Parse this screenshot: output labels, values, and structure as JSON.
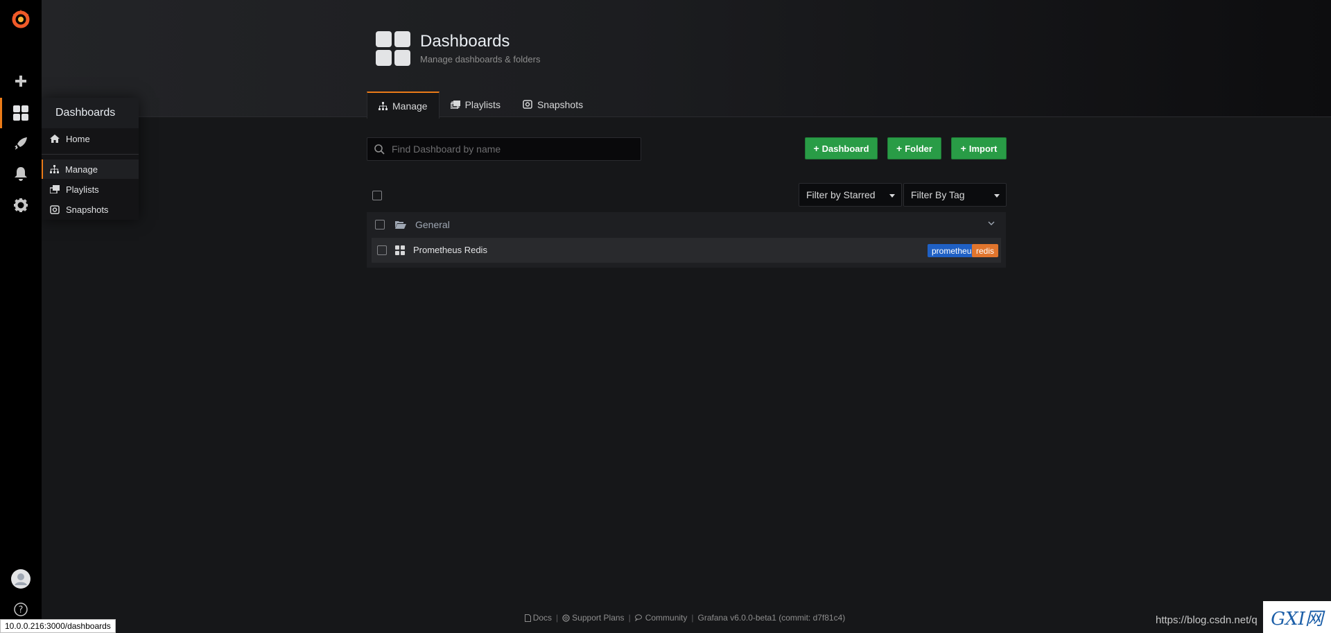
{
  "header": {
    "title": "Dashboards",
    "subtitle": "Manage dashboards & folders"
  },
  "tabs": [
    {
      "label": "Manage",
      "icon": "sitemap-icon",
      "active": true
    },
    {
      "label": "Playlists",
      "icon": "playlist-icon",
      "active": false
    },
    {
      "label": "Snapshots",
      "icon": "camera-icon",
      "active": false
    }
  ],
  "search": {
    "placeholder": "Find Dashboard by name",
    "value": ""
  },
  "actions": {
    "new_dashboard": "Dashboard",
    "new_folder": "Folder",
    "import": "Import"
  },
  "filters": {
    "starred": "Filter by Starred",
    "tag": "Filter By Tag"
  },
  "folders": [
    {
      "name": "General",
      "dashboards": [
        {
          "name": "Prometheus Redis",
          "tags": [
            {
              "label": "prometheus",
              "color": "#1f60c4"
            },
            {
              "label": "redis",
              "color": "#e0752d"
            }
          ]
        }
      ]
    }
  ],
  "sidemenu_dropdown": {
    "title": "Dashboards",
    "items": [
      {
        "label": "Home",
        "icon": "home-icon"
      },
      {
        "label": "Manage",
        "icon": "sitemap-icon",
        "active": true
      },
      {
        "label": "Playlists",
        "icon": "playlist-icon"
      },
      {
        "label": "Snapshots",
        "icon": "camera-icon"
      }
    ]
  },
  "footer": {
    "docs": "Docs",
    "support": "Support Plans",
    "community": "Community",
    "version": "Grafana v6.0.0-beta1 (commit: d7f81c4)"
  },
  "status_bar_url": "10.0.0.216:3000/dashboards",
  "watermark": {
    "url": "https://blog.csdn.net/q",
    "logo": "GXI网"
  },
  "colors": {
    "accent": "#eb7b18",
    "primary_button": "#299c46",
    "background": "#161719",
    "sidebar": "#000000"
  }
}
